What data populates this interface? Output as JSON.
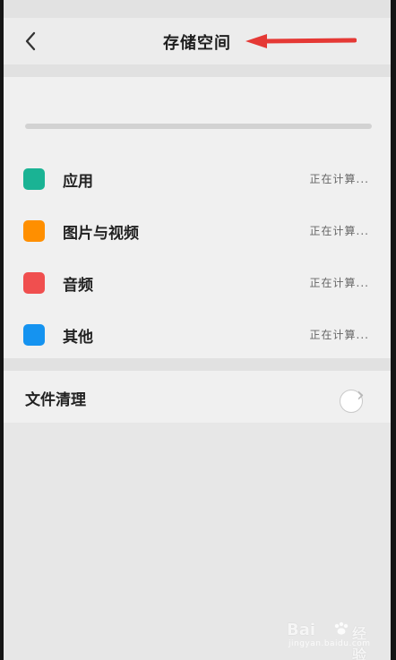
{
  "header": {
    "title": "存储空间",
    "back_icon": "chevron-left-icon"
  },
  "storage_categories": [
    {
      "label": "应用",
      "status": "正在计算...",
      "color": "#1ab394"
    },
    {
      "label": "图片与视频",
      "status": "正在计算...",
      "color": "#ff8f00"
    },
    {
      "label": "音频",
      "status": "正在计算...",
      "color": "#f04f4f"
    },
    {
      "label": "其他",
      "status": "正在计算...",
      "color": "#1593f0"
    }
  ],
  "cleanup": {
    "label": "文件清理",
    "icon": "chevron-right-icon"
  },
  "watermark": {
    "brand": "Bai",
    "cn": "经验",
    "sub": "jingyan.baidu.com"
  },
  "colors": {
    "annotation_arrow": "#e53935",
    "background": "#e9e9e9",
    "card": "#f0f0f0"
  }
}
